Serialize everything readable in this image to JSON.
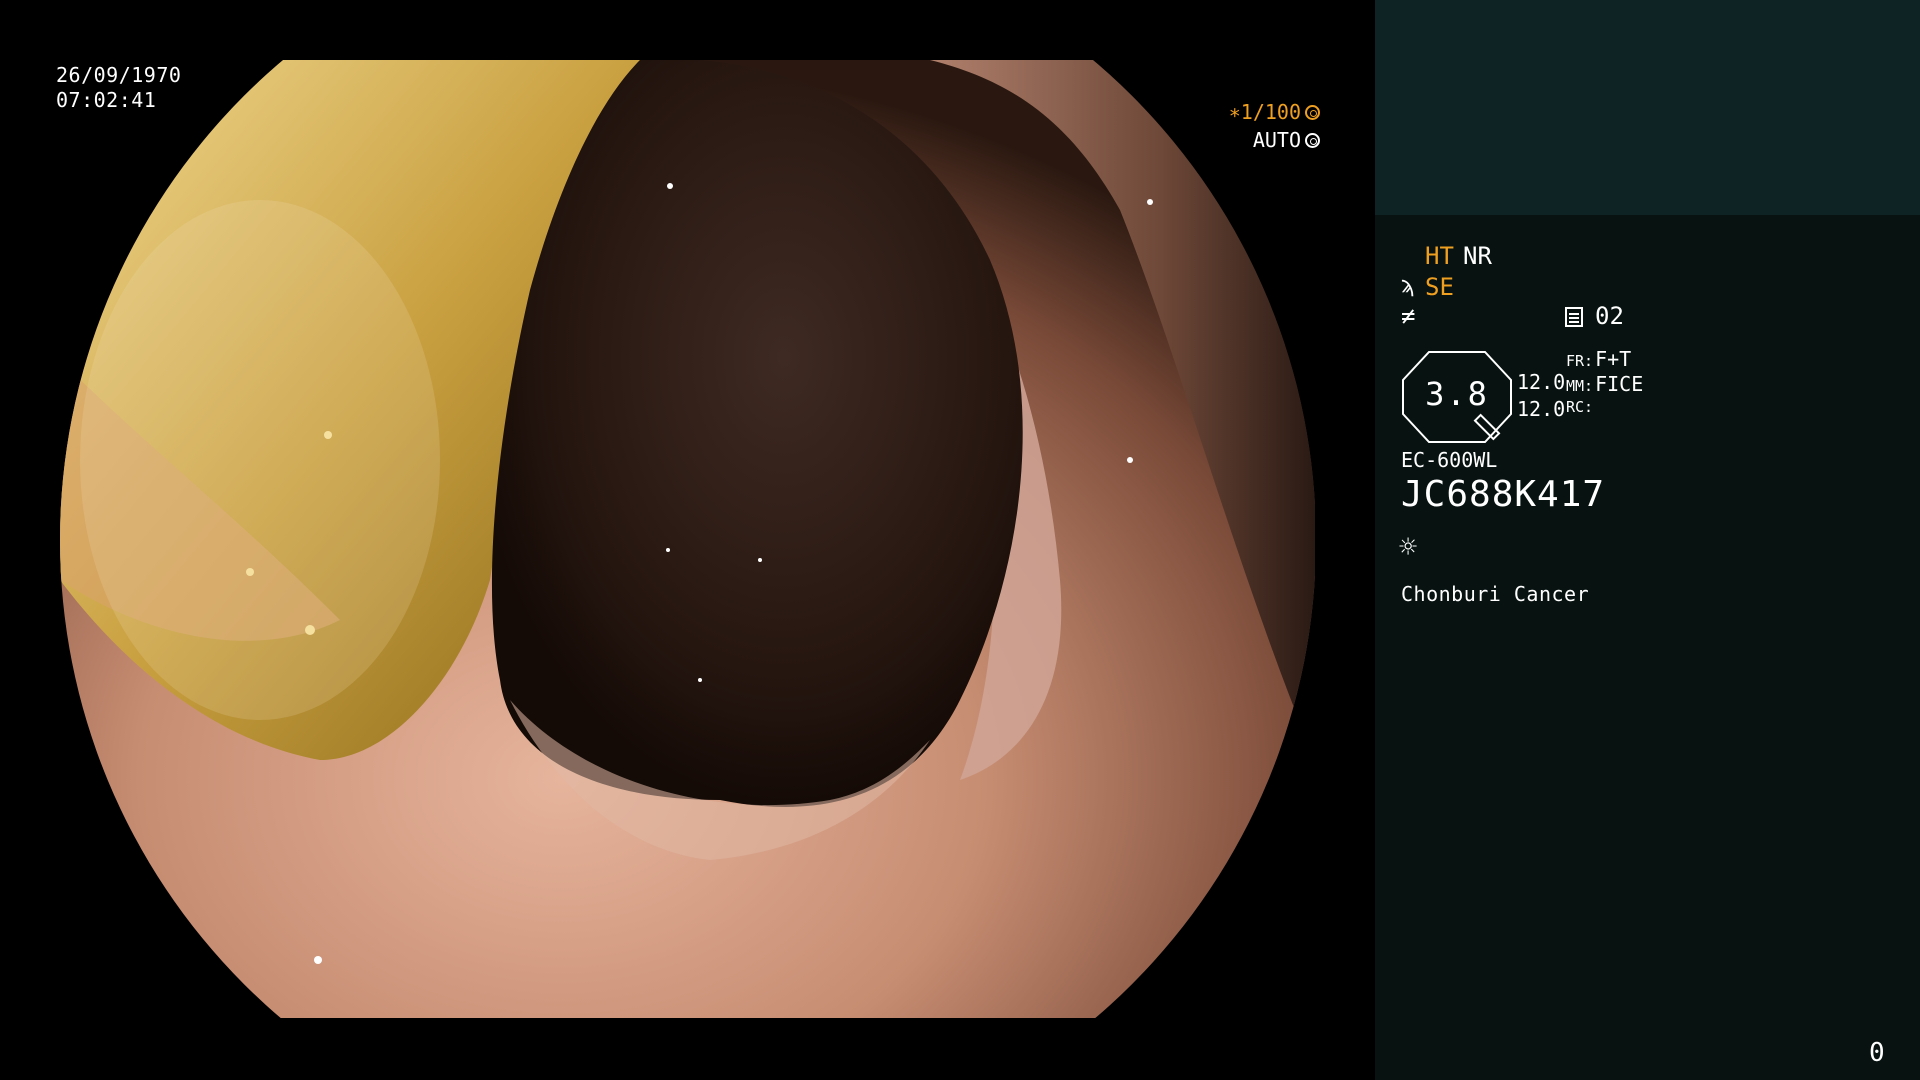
{
  "viewport": {
    "date": "26/09/1970",
    "time": "07:02:41",
    "shutter_label": "∗1/100",
    "shutter_icon": "aperture-icon",
    "exposure_label": "AUTO",
    "exposure_icon": "iris-icon"
  },
  "panel": {
    "ht_label": "HT",
    "nr_label": "NR",
    "se_icon": "enhance-curve-icon",
    "se_label": "SE",
    "contrast_icon": "not-equal-icon",
    "memory_icon": "memory-card-icon",
    "memory_value": "02",
    "zoom_value": "3.8",
    "value_a": "12.0",
    "value_b": "12.0",
    "fr_key": "FR:",
    "fr_value": "F+T",
    "mm_key": "MM:",
    "mm_value": "FICE",
    "rc_key": "RC:",
    "rc_value": "",
    "scope_model": "EC-600WL",
    "scope_serial": "JC688K417",
    "light_icon": "light-source-icon",
    "hospital": "Chonburi Cancer",
    "frame_counter": "0"
  },
  "colors": {
    "accent": "#f0a020",
    "panel_bg": "#071211",
    "panel_header_bg": "#0e2324"
  }
}
